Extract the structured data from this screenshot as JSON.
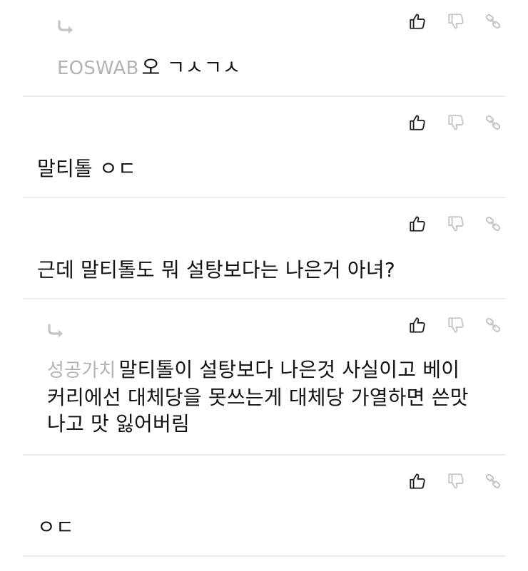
{
  "icons": {
    "like": "thumbs-up-icon",
    "dislike": "thumbs-down-icon",
    "link": "link-icon",
    "reply": "reply-arrow-icon"
  },
  "colors": {
    "author": "#b3b3b3",
    "divider": "#ececec",
    "icon_dark": "#222222",
    "icon_light": "#c4c4c4"
  },
  "comments": [
    {
      "is_reply": true,
      "author": "EOSWAB",
      "text": "오 ㄱㅅㄱㅅ"
    },
    {
      "is_reply": false,
      "author": "",
      "text": "말티톨 ㅇㄷ"
    },
    {
      "is_reply": false,
      "author": "",
      "text": "근데 말티톨도 뭐 설탕보다는 나은거 아녀?"
    },
    {
      "is_reply": true,
      "author": "성공가치",
      "text": "말티톨이 설탕보다 나은것 사실이고 베이커리에선 대체당을 못쓰는게 대체당 가열하면 쓴맛나고 맛 잃어버림"
    },
    {
      "is_reply": false,
      "author": "",
      "text": "ㅇㄷ"
    }
  ]
}
